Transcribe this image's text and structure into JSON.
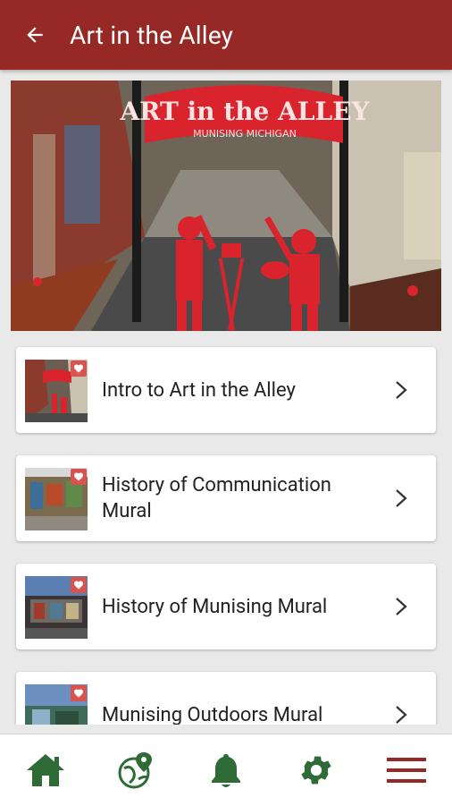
{
  "header": {
    "title": "Art in the Alley"
  },
  "hero": {
    "sign_top": "ART in the ALLEY",
    "sign_bottom": "MUNISING MICHIGAN"
  },
  "list": [
    {
      "label": "Intro to Art in the Alley"
    },
    {
      "label": "History of Communication Mural"
    },
    {
      "label": "History of Munising Mural"
    },
    {
      "label": "Munising Outdoors Mural"
    }
  ],
  "bottom_nav": [
    "home-icon",
    "globe-pin-icon",
    "bell-icon",
    "gear-icon",
    "menu-icon"
  ],
  "colors": {
    "brand": "#962925",
    "nav_green": "#2e6b36",
    "heart": "#d9534f"
  }
}
